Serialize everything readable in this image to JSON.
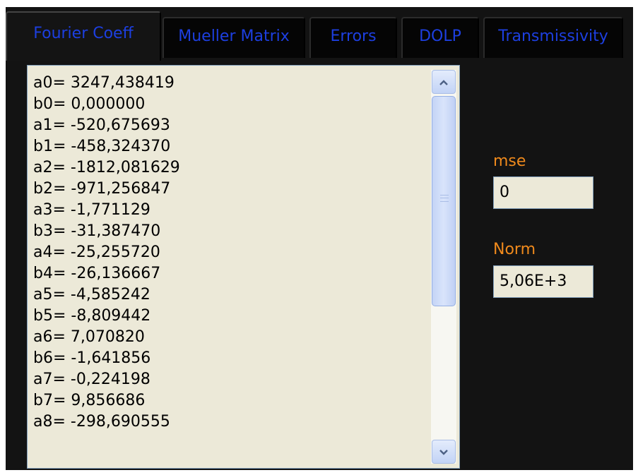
{
  "tabs": [
    {
      "label": "Fourier Coeff",
      "active": true
    },
    {
      "label": "Mueller Matrix",
      "active": false
    },
    {
      "label": "Errors",
      "active": false
    },
    {
      "label": "DOLP",
      "active": false
    },
    {
      "label": "Transmissivity",
      "active": false
    }
  ],
  "coefficients": [
    "a0= 3247,438419",
    "b0= 0,000000",
    "a1= -520,675693",
    "b1= -458,324370",
    "a2= -1812,081629",
    "b2= -971,256847",
    "a3= -1,771129",
    "b3= -31,387470",
    "a4= -25,255720",
    "b4= -26,136667",
    "a5= -4,585242",
    "b5= -8,809442",
    "a6= 7,070820",
    "b6= -1,641856",
    "a7= -0,224198",
    "b7= 9,856686",
    "a8= -298,690555"
  ],
  "scrollbar": {
    "up_icon": "chevron-up-icon",
    "down_icon": "chevron-down-icon",
    "thumb_grip_icon": "grip-lines-icon"
  },
  "mse": {
    "label": "mse",
    "value": "0"
  },
  "norm": {
    "label": "Norm",
    "value": "5,06E+3"
  },
  "colors": {
    "panel_background": "#131313",
    "tab_text": "#1d3fe0",
    "field_label": "#f08a1c",
    "field_background": "#ece9d8"
  }
}
